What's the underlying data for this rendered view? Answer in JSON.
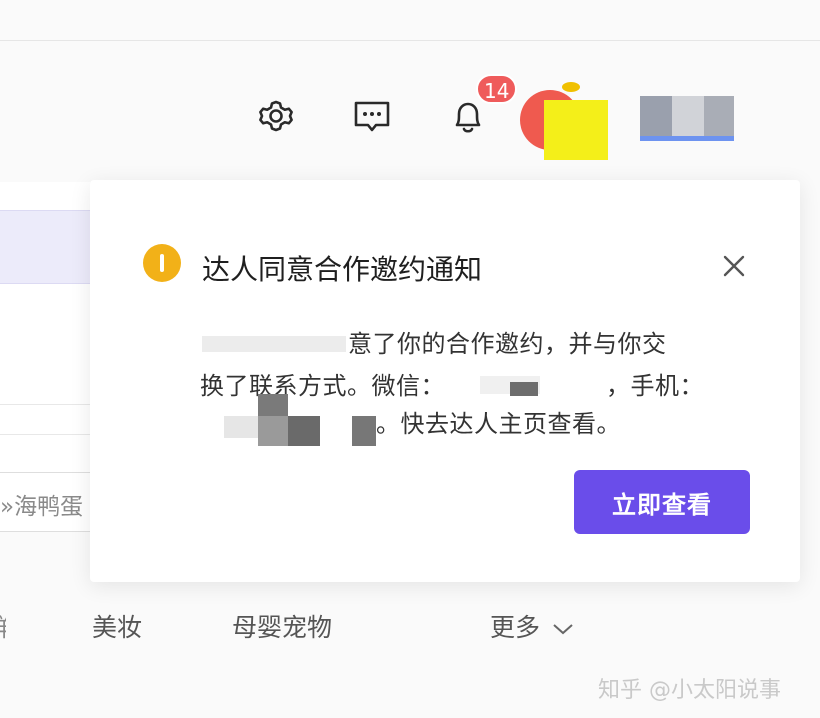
{
  "header": {
    "icons": [
      "gear-icon",
      "chat-icon",
      "bell-icon"
    ],
    "notification_count": "14",
    "accent_red": "#ef5b5b"
  },
  "background": {
    "search_fragment": "»海鸭蛋",
    "categories": [
      "美妆",
      "母婴宠物",
      "更多"
    ]
  },
  "popup": {
    "title": "达人同意合作邀约通知",
    "body_line1": "意了你的合作邀约，并与你交",
    "body_line2": "换了联系方式。微信：",
    "body_line2_tail": "，手机：",
    "body_line3": "。快去达人主页查看。",
    "button_label": "立即查看",
    "button_color": "#6a4dea",
    "icon_color": "#f2b118"
  },
  "watermark": "知乎 @小太阳说事"
}
